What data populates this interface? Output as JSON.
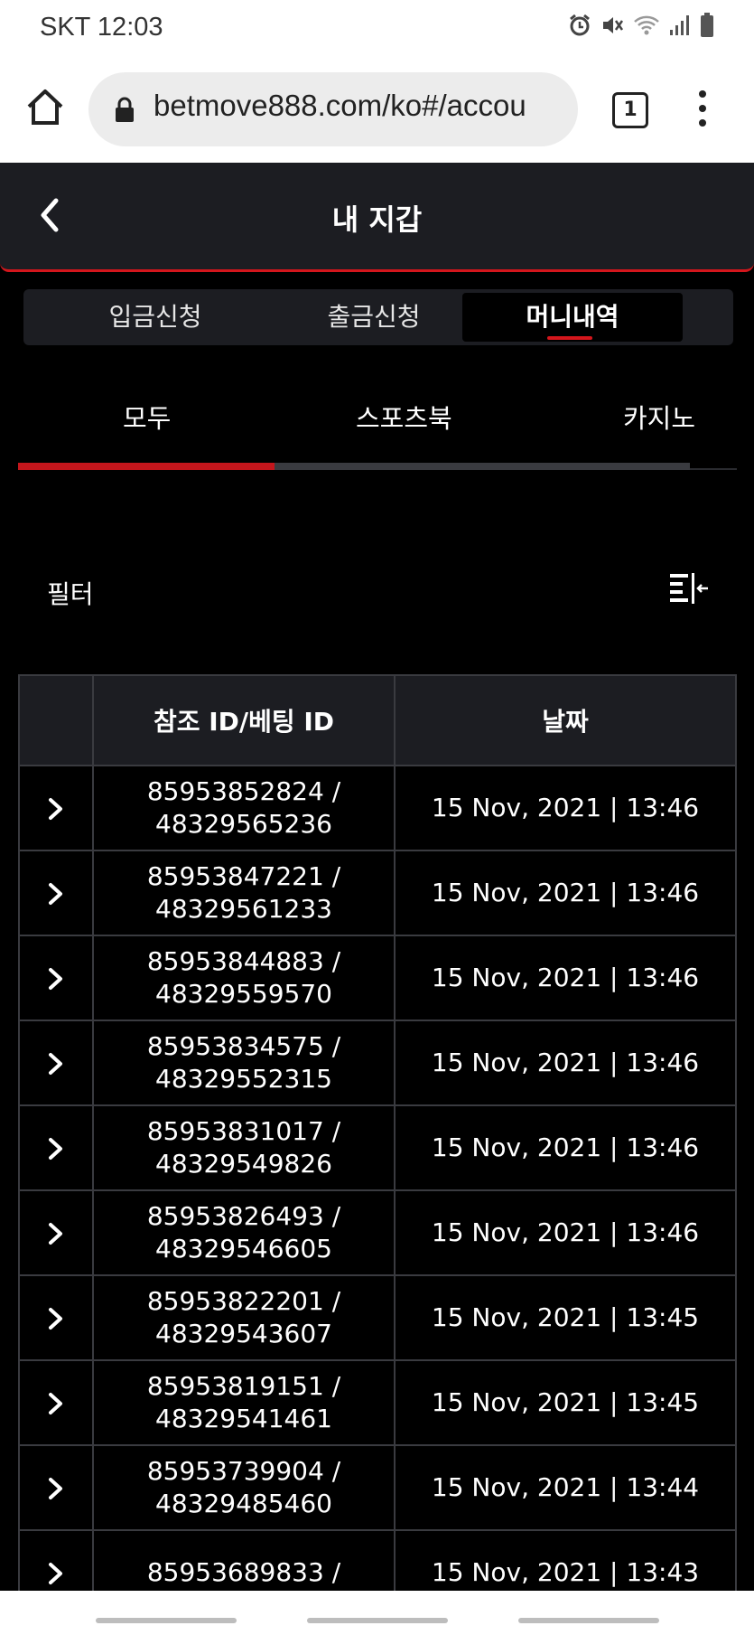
{
  "status_bar": {
    "carrier_time": "SKT 12:03",
    "icons": [
      "alarm-icon",
      "mute-icon",
      "wifi-icon",
      "signal-icon",
      "battery-icon"
    ]
  },
  "browser": {
    "url": "betmove888.com/ko#/accou",
    "tab_count": "1",
    "icons": [
      "home-icon",
      "lock-icon",
      "more-vert-icon"
    ]
  },
  "header": {
    "title": "내 지갑",
    "accent_color": "#d4161c"
  },
  "segmented_tabs": [
    {
      "label": "입금신청",
      "active": false
    },
    {
      "label": "출금신청",
      "active": false
    },
    {
      "label": "머니내역",
      "active": true
    }
  ],
  "category_tabs": [
    {
      "label": "모두",
      "active": true
    },
    {
      "label": "스포츠북",
      "active": false
    },
    {
      "label": "카지노",
      "active": false
    }
  ],
  "filter": {
    "label": "필터",
    "icon": "filter-collapse-icon"
  },
  "table": {
    "headers": [
      "",
      "참조 ID/베팅 ID",
      "날짜"
    ],
    "rows": [
      {
        "ref_id": "85953852824 /",
        "bet_id": "48329565236",
        "date": "15 Nov, 2021 | 13:46"
      },
      {
        "ref_id": "85953847221 /",
        "bet_id": "48329561233",
        "date": "15 Nov, 2021 | 13:46"
      },
      {
        "ref_id": "85953844883 /",
        "bet_id": "48329559570",
        "date": "15 Nov, 2021 | 13:46"
      },
      {
        "ref_id": "85953834575 /",
        "bet_id": "48329552315",
        "date": "15 Nov, 2021 | 13:46"
      },
      {
        "ref_id": "85953831017 /",
        "bet_id": "48329549826",
        "date": "15 Nov, 2021 | 13:46"
      },
      {
        "ref_id": "85953826493 /",
        "bet_id": "48329546605",
        "date": "15 Nov, 2021 | 13:46"
      },
      {
        "ref_id": "85953822201 /",
        "bet_id": "48329543607",
        "date": "15 Nov, 2021 | 13:45"
      },
      {
        "ref_id": "85953819151 /",
        "bet_id": "48329541461",
        "date": "15 Nov, 2021 | 13:45"
      },
      {
        "ref_id": "85953739904 /",
        "bet_id": "48329485460",
        "date": "15 Nov, 2021 | 13:44"
      },
      {
        "ref_id": "85953689833 /",
        "bet_id": "",
        "date": "15 Nov, 2021 | 13:43"
      }
    ]
  }
}
